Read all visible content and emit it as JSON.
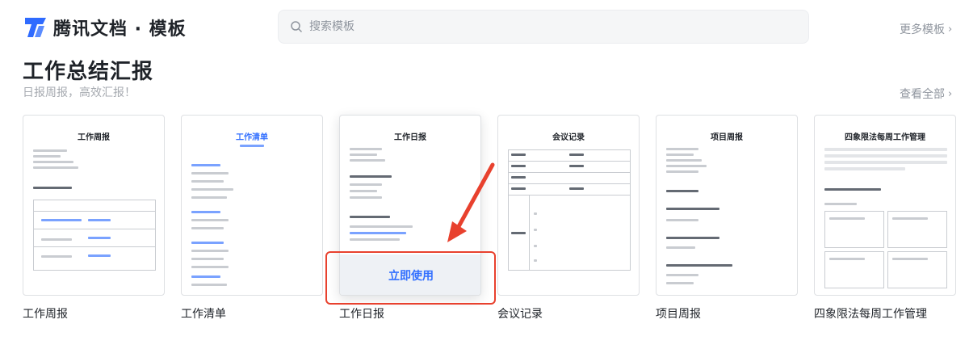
{
  "header": {
    "logo_text": "腾讯文档 · 模板",
    "search_placeholder": "搜索模板",
    "more_templates": "更多模板",
    "brand_color": "#2f6bff"
  },
  "section": {
    "title": "工作总结汇报",
    "subtitle": "日报周报，高效汇报！",
    "view_all": "查看全部"
  },
  "cards": [
    {
      "label": "工作周报",
      "doc_title": "工作周报"
    },
    {
      "label": "工作清单",
      "doc_title": "工作清单"
    },
    {
      "label": "工作日报",
      "doc_title": "工作日报",
      "use_button": "立即使用"
    },
    {
      "label": "会议记录",
      "doc_title": "会议记录"
    },
    {
      "label": "项目周报",
      "doc_title": "项目周报"
    },
    {
      "label": "四象限法每周工作管理",
      "doc_title": "四象限法每周工作管理"
    }
  ],
  "icons": {
    "search": "search-icon",
    "chevron": "chevron-right-icon",
    "logo": "tencent-docs-logo-icon"
  },
  "annotation_color": "#e8412e"
}
